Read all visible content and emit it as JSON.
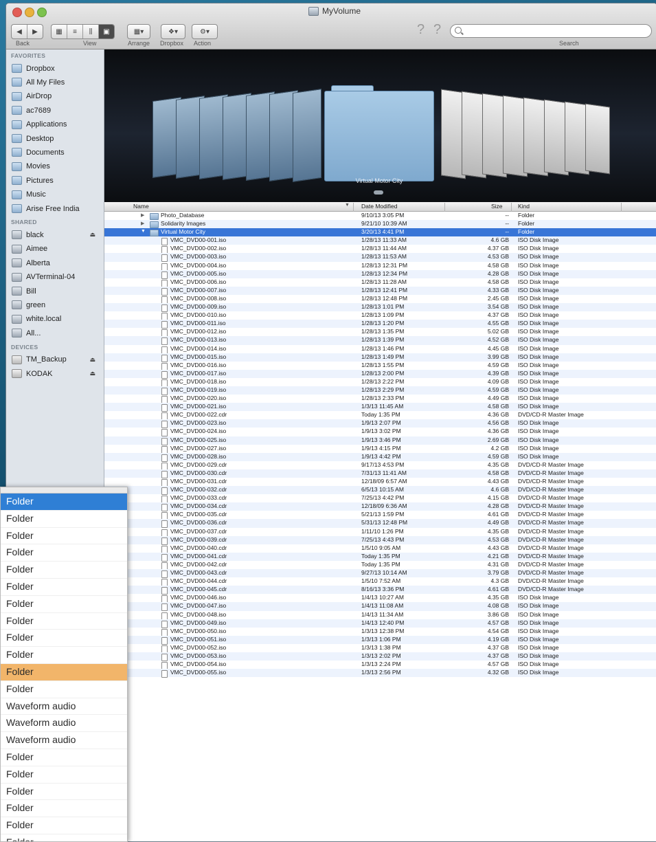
{
  "window": {
    "title": "MyVolume"
  },
  "toolbar": {
    "labels": {
      "back": "Back",
      "view": "View",
      "arrange": "Arrange",
      "dropbox": "Dropbox",
      "action": "Action",
      "search": "Search"
    },
    "search_placeholder": ""
  },
  "sidebar": {
    "favorites_header": "FAVORITES",
    "favorites": [
      "Dropbox",
      "All My Files",
      "AirDrop",
      "ac7689",
      "Applications",
      "Desktop",
      "Documents",
      "Movies",
      "Pictures",
      "Music",
      "Arise Free India"
    ],
    "shared_header": "SHARED",
    "shared": [
      "black",
      "Aimee",
      "Alberta",
      "AVTerminal-04",
      "Bill",
      "green",
      "white.local",
      "All..."
    ],
    "devices_header": "DEVICES",
    "devices": [
      "TM_Backup",
      "KODAK"
    ]
  },
  "coverflow": {
    "caption": "Virtual Motor City"
  },
  "columns": {
    "name": "Name",
    "date": "Date Modified",
    "size": "Size",
    "kind": "Kind"
  },
  "rows": [
    {
      "name": "Photo_Database",
      "date": "9/10/13 3:05 PM",
      "size": "--",
      "kind": "Folder",
      "level": 0,
      "type": "folder",
      "disclosure": "closed"
    },
    {
      "name": "Solidarity Images",
      "date": "9/21/10 10:39 AM",
      "size": "--",
      "kind": "Folder",
      "level": 0,
      "type": "folder",
      "disclosure": "closed"
    },
    {
      "name": "Virtual Motor City",
      "date": "3/20/13 4:41 PM",
      "size": "--",
      "kind": "Folder",
      "level": 0,
      "type": "folder",
      "disclosure": "open",
      "selected": true
    },
    {
      "name": "VMC_DVD00-001.iso",
      "date": "1/28/13 11:33 AM",
      "size": "4.6 GB",
      "kind": "ISO Disk Image",
      "level": 1,
      "type": "doc"
    },
    {
      "name": "VMC_DVD00-002.iso",
      "date": "1/28/13 11:44 AM",
      "size": "4.37 GB",
      "kind": "ISO Disk Image",
      "level": 1,
      "type": "doc"
    },
    {
      "name": "VMC_DVD00-003.iso",
      "date": "1/28/13 11:53 AM",
      "size": "4.53 GB",
      "kind": "ISO Disk Image",
      "level": 1,
      "type": "doc"
    },
    {
      "name": "VMC_DVD00-004.iso",
      "date": "1/28/13 12:31 PM",
      "size": "4.58 GB",
      "kind": "ISO Disk Image",
      "level": 1,
      "type": "doc"
    },
    {
      "name": "VMC_DVD00-005.iso",
      "date": "1/28/13 12:34 PM",
      "size": "4.28 GB",
      "kind": "ISO Disk Image",
      "level": 1,
      "type": "doc"
    },
    {
      "name": "VMC_DVD00-006.iso",
      "date": "1/28/13 11:28 AM",
      "size": "4.58 GB",
      "kind": "ISO Disk Image",
      "level": 1,
      "type": "doc"
    },
    {
      "name": "VMC_DVD00-007.iso",
      "date": "1/28/13 12:41 PM",
      "size": "4.33 GB",
      "kind": "ISO Disk Image",
      "level": 1,
      "type": "doc"
    },
    {
      "name": "VMC_DVD00-008.iso",
      "date": "1/28/13 12:48 PM",
      "size": "2.45 GB",
      "kind": "ISO Disk Image",
      "level": 1,
      "type": "doc"
    },
    {
      "name": "VMC_DVD00-009.iso",
      "date": "1/28/13 1:01 PM",
      "size": "3.54 GB",
      "kind": "ISO Disk Image",
      "level": 1,
      "type": "doc"
    },
    {
      "name": "VMC_DVD00-010.iso",
      "date": "1/28/13 1:09 PM",
      "size": "4.37 GB",
      "kind": "ISO Disk Image",
      "level": 1,
      "type": "doc"
    },
    {
      "name": "VMC_DVD00-011.iso",
      "date": "1/28/13 1:20 PM",
      "size": "4.55 GB",
      "kind": "ISO Disk Image",
      "level": 1,
      "type": "doc"
    },
    {
      "name": "VMC_DVD00-012.iso",
      "date": "1/28/13 1:35 PM",
      "size": "5.02 GB",
      "kind": "ISO Disk Image",
      "level": 1,
      "type": "doc"
    },
    {
      "name": "VMC_DVD00-013.iso",
      "date": "1/28/13 1:39 PM",
      "size": "4.52 GB",
      "kind": "ISO Disk Image",
      "level": 1,
      "type": "doc"
    },
    {
      "name": "VMC_DVD00-014.iso",
      "date": "1/28/13 1:46 PM",
      "size": "4.45 GB",
      "kind": "ISO Disk Image",
      "level": 1,
      "type": "doc"
    },
    {
      "name": "VMC_DVD00-015.iso",
      "date": "1/28/13 1:49 PM",
      "size": "3.99 GB",
      "kind": "ISO Disk Image",
      "level": 1,
      "type": "doc"
    },
    {
      "name": "VMC_DVD00-016.iso",
      "date": "1/28/13 1:55 PM",
      "size": "4.59 GB",
      "kind": "ISO Disk Image",
      "level": 1,
      "type": "doc"
    },
    {
      "name": "VMC_DVD00-017.iso",
      "date": "1/28/13 2:00 PM",
      "size": "4.39 GB",
      "kind": "ISO Disk Image",
      "level": 1,
      "type": "doc"
    },
    {
      "name": "VMC_DVD00-018.iso",
      "date": "1/28/13 2:22 PM",
      "size": "4.09 GB",
      "kind": "ISO Disk Image",
      "level": 1,
      "type": "doc"
    },
    {
      "name": "VMC_DVD00-019.iso",
      "date": "1/28/13 2:29 PM",
      "size": "4.59 GB",
      "kind": "ISO Disk Image",
      "level": 1,
      "type": "doc"
    },
    {
      "name": "VMC_DVD00-020.iso",
      "date": "1/28/13 2:33 PM",
      "size": "4.49 GB",
      "kind": "ISO Disk Image",
      "level": 1,
      "type": "doc"
    },
    {
      "name": "VMC_DVD00-021.iso",
      "date": "1/3/13 11:45 AM",
      "size": "4.58 GB",
      "kind": "ISO Disk Image",
      "level": 1,
      "type": "doc"
    },
    {
      "name": "VMC_DVD00-022.cdr",
      "date": "Today 1:35 PM",
      "size": "4.36 GB",
      "kind": "DVD/CD-R Master Image",
      "level": 1,
      "type": "doc"
    },
    {
      "name": "VMC_DVD00-023.iso",
      "date": "1/9/13 2:07 PM",
      "size": "4.56 GB",
      "kind": "ISO Disk Image",
      "level": 1,
      "type": "doc"
    },
    {
      "name": "VMC_DVD00-024.iso",
      "date": "1/9/13 3:02 PM",
      "size": "4.36 GB",
      "kind": "ISO Disk Image",
      "level": 1,
      "type": "doc"
    },
    {
      "name": "VMC_DVD00-025.iso",
      "date": "1/9/13 3:46 PM",
      "size": "2.69 GB",
      "kind": "ISO Disk Image",
      "level": 1,
      "type": "doc"
    },
    {
      "name": "VMC_DVD00-027.iso",
      "date": "1/9/13 4:15 PM",
      "size": "4.2 GB",
      "kind": "ISO Disk Image",
      "level": 1,
      "type": "doc"
    },
    {
      "name": "VMC_DVD00-028.iso",
      "date": "1/9/13 4:42 PM",
      "size": "4.59 GB",
      "kind": "ISO Disk Image",
      "level": 1,
      "type": "doc"
    },
    {
      "name": "VMC_DVD00-029.cdr",
      "date": "9/17/13 4:53 PM",
      "size": "4.35 GB",
      "kind": "DVD/CD-R Master Image",
      "level": 1,
      "type": "doc"
    },
    {
      "name": "VMC_DVD00-030.cdr",
      "date": "7/31/13 11:41 AM",
      "size": "4.58 GB",
      "kind": "DVD/CD-R Master Image",
      "level": 1,
      "type": "doc"
    },
    {
      "name": "VMC_DVD00-031.cdr",
      "date": "12/18/09 6:57 AM",
      "size": "4.43 GB",
      "kind": "DVD/CD-R Master Image",
      "level": 1,
      "type": "doc"
    },
    {
      "name": "VMC_DVD00-032.cdr",
      "date": "6/5/13 10:15 AM",
      "size": "4.6 GB",
      "kind": "DVD/CD-R Master Image",
      "level": 1,
      "type": "doc"
    },
    {
      "name": "VMC_DVD00-033.cdr",
      "date": "7/25/13 4:42 PM",
      "size": "4.15 GB",
      "kind": "DVD/CD-R Master Image",
      "level": 1,
      "type": "doc"
    },
    {
      "name": "VMC_DVD00-034.cdr",
      "date": "12/18/09 6:36 AM",
      "size": "4.28 GB",
      "kind": "DVD/CD-R Master Image",
      "level": 1,
      "type": "doc"
    },
    {
      "name": "VMC_DVD00-035.cdr",
      "date": "5/21/13 1:59 PM",
      "size": "4.61 GB",
      "kind": "DVD/CD-R Master Image",
      "level": 1,
      "type": "doc"
    },
    {
      "name": "VMC_DVD00-036.cdr",
      "date": "5/31/13 12:48 PM",
      "size": "4.49 GB",
      "kind": "DVD/CD-R Master Image",
      "level": 1,
      "type": "doc"
    },
    {
      "name": "VMC_DVD00-037.cdr",
      "date": "1/11/10 1:26 PM",
      "size": "4.35 GB",
      "kind": "DVD/CD-R Master Image",
      "level": 1,
      "type": "doc"
    },
    {
      "name": "VMC_DVD00-039.cdr",
      "date": "7/25/13 4:43 PM",
      "size": "4.53 GB",
      "kind": "DVD/CD-R Master Image",
      "level": 1,
      "type": "doc"
    },
    {
      "name": "VMC_DVD00-040.cdr",
      "date": "1/5/10 9:05 AM",
      "size": "4.43 GB",
      "kind": "DVD/CD-R Master Image",
      "level": 1,
      "type": "doc"
    },
    {
      "name": "VMC_DVD00-041.cdr",
      "date": "Today 1:35 PM",
      "size": "4.21 GB",
      "kind": "DVD/CD-R Master Image",
      "level": 1,
      "type": "doc"
    },
    {
      "name": "VMC_DVD00-042.cdr",
      "date": "Today 1:35 PM",
      "size": "4.31 GB",
      "kind": "DVD/CD-R Master Image",
      "level": 1,
      "type": "doc"
    },
    {
      "name": "VMC_DVD00-043.cdr",
      "date": "9/27/13 10:14 AM",
      "size": "3.79 GB",
      "kind": "DVD/CD-R Master Image",
      "level": 1,
      "type": "doc"
    },
    {
      "name": "VMC_DVD00-044.cdr",
      "date": "1/5/10 7:52 AM",
      "size": "4.3 GB",
      "kind": "DVD/CD-R Master Image",
      "level": 1,
      "type": "doc"
    },
    {
      "name": "VMC_DVD00-045.cdr",
      "date": "8/16/13 3:36 PM",
      "size": "4.61 GB",
      "kind": "DVD/CD-R Master Image",
      "level": 1,
      "type": "doc"
    },
    {
      "name": "VMC_DVD00-046.iso",
      "date": "1/4/13 10:27 AM",
      "size": "4.35 GB",
      "kind": "ISO Disk Image",
      "level": 1,
      "type": "doc"
    },
    {
      "name": "VMC_DVD00-047.iso",
      "date": "1/4/13 11:08 AM",
      "size": "4.08 GB",
      "kind": "ISO Disk Image",
      "level": 1,
      "type": "doc"
    },
    {
      "name": "VMC_DVD00-048.iso",
      "date": "1/4/13 11:34 AM",
      "size": "3.86 GB",
      "kind": "ISO Disk Image",
      "level": 1,
      "type": "doc"
    },
    {
      "name": "VMC_DVD00-049.iso",
      "date": "1/4/13 12:40 PM",
      "size": "4.57 GB",
      "kind": "ISO Disk Image",
      "level": 1,
      "type": "doc"
    },
    {
      "name": "VMC_DVD00-050.iso",
      "date": "1/3/13 12:38 PM",
      "size": "4.54 GB",
      "kind": "ISO Disk Image",
      "level": 1,
      "type": "doc"
    },
    {
      "name": "VMC_DVD00-051.iso",
      "date": "1/3/13 1:06 PM",
      "size": "4.19 GB",
      "kind": "ISO Disk Image",
      "level": 1,
      "type": "doc"
    },
    {
      "name": "VMC_DVD00-052.iso",
      "date": "1/3/13 1:38 PM",
      "size": "4.37 GB",
      "kind": "ISO Disk Image",
      "level": 1,
      "type": "doc"
    },
    {
      "name": "VMC_DVD00-053.iso",
      "date": "1/3/13 2:02 PM",
      "size": "4.37 GB",
      "kind": "ISO Disk Image",
      "level": 1,
      "type": "doc"
    },
    {
      "name": "VMC_DVD00-054.iso",
      "date": "1/3/13 2:24 PM",
      "size": "4.57 GB",
      "kind": "ISO Disk Image",
      "level": 1,
      "type": "doc"
    },
    {
      "name": "VMC_DVD00-055.iso",
      "date": "1/3/13 2:56 PM",
      "size": "4.32 GB",
      "kind": "ISO Disk Image",
      "level": 1,
      "type": "doc"
    }
  ],
  "overlay_list": {
    "items": [
      {
        "label": "Folder",
        "state": "selected-blue"
      },
      {
        "label": "Folder",
        "state": ""
      },
      {
        "label": "Folder",
        "state": ""
      },
      {
        "label": "Folder",
        "state": ""
      },
      {
        "label": "Folder",
        "state": ""
      },
      {
        "label": "Folder",
        "state": ""
      },
      {
        "label": "Folder",
        "state": ""
      },
      {
        "label": "Folder",
        "state": ""
      },
      {
        "label": "Folder",
        "state": ""
      },
      {
        "label": "Folder",
        "state": ""
      },
      {
        "label": "Folder",
        "state": "selected-orange"
      },
      {
        "label": "Folder",
        "state": ""
      },
      {
        "label": "Waveform audio",
        "state": ""
      },
      {
        "label": "Waveform audio",
        "state": ""
      },
      {
        "label": "Waveform audio",
        "state": ""
      },
      {
        "label": "Folder",
        "state": ""
      },
      {
        "label": "Folder",
        "state": ""
      },
      {
        "label": "Folder",
        "state": ""
      },
      {
        "label": "Folder",
        "state": ""
      },
      {
        "label": "Folder",
        "state": ""
      },
      {
        "label": "Folder",
        "state": ""
      },
      {
        "label": "Folder",
        "state": ""
      }
    ]
  },
  "colors": {
    "selection_blue": "#3875d7",
    "overlay_blue": "#2f7fd5",
    "overlay_orange": "#f2b56a",
    "sidebar_bg": "#dfe4ea",
    "row_stripe": "#edf3fd"
  }
}
